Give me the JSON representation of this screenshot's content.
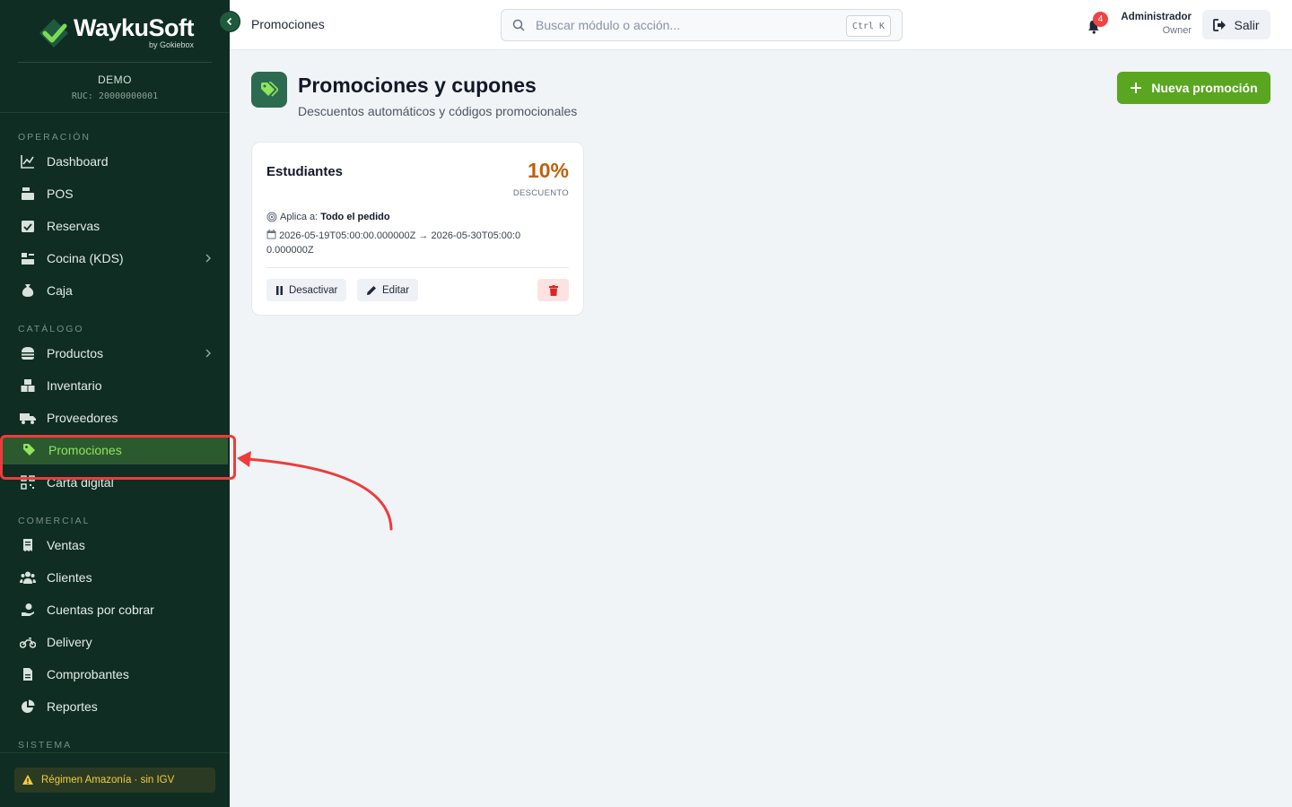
{
  "brand": {
    "name": "WaykuSoft",
    "sub": "by Gokiebox"
  },
  "company": {
    "name": "DEMO",
    "ruc": "RUC: 20000000001"
  },
  "sidebar": {
    "sections": [
      {
        "title": "OPERACIÓN",
        "items": [
          {
            "label": "Dashboard",
            "icon": "chart-line-icon"
          },
          {
            "label": "POS",
            "icon": "cash-register-icon"
          },
          {
            "label": "Reservas",
            "icon": "calendar-check-icon"
          },
          {
            "label": "Cocina (KDS)",
            "icon": "kitchen-icon",
            "has_children": true
          },
          {
            "label": "Caja",
            "icon": "money-bag-icon"
          }
        ]
      },
      {
        "title": "CATÁLOGO",
        "items": [
          {
            "label": "Productos",
            "icon": "burger-icon",
            "has_children": true
          },
          {
            "label": "Inventario",
            "icon": "boxes-icon"
          },
          {
            "label": "Proveedores",
            "icon": "truck-icon"
          },
          {
            "label": "Promociones",
            "icon": "tags-icon",
            "active": true
          },
          {
            "label": "Carta digital",
            "icon": "qr-code-icon"
          }
        ]
      },
      {
        "title": "COMERCIAL",
        "items": [
          {
            "label": "Ventas",
            "icon": "receipt-icon"
          },
          {
            "label": "Clientes",
            "icon": "users-icon"
          },
          {
            "label": "Cuentas por cobrar",
            "icon": "hand-dollar-icon"
          },
          {
            "label": "Delivery",
            "icon": "motorcycle-icon"
          },
          {
            "label": "Comprobantes",
            "icon": "file-invoice-icon"
          },
          {
            "label": "Reportes",
            "icon": "pie-chart-icon"
          }
        ]
      },
      {
        "title": "SISTEMA",
        "items": []
      }
    ],
    "regimen": "Régimen Amazonía · sin IGV"
  },
  "topbar": {
    "title": "Promociones",
    "search_placeholder": "Buscar módulo o acción...",
    "shortcut": "Ctrl K",
    "notifications": "4",
    "user_name": "Administrador",
    "user_role": "Owner",
    "logout": "Salir"
  },
  "page": {
    "title": "Promociones y cupones",
    "subtitle": "Descuentos automáticos y códigos promocionales",
    "new_button": "Nueva promoción"
  },
  "promotions": [
    {
      "name": "Estudiantes",
      "value": "10%",
      "value_label": "DESCUENTO",
      "applies_label": "Aplica a:",
      "applies_value": "Todo el pedido",
      "dates": "2026-05-19T05:00:00.000000Z → 2026-05-30T05:00:00.000000Z",
      "deactivate": "Desactivar",
      "edit": "Editar"
    }
  ],
  "colors": {
    "sidebar": "#0f2d22",
    "accent": "#5aa620",
    "active_text": "#8fe45c",
    "discount": "#c2600a",
    "annotation": "#ef3b3b"
  }
}
